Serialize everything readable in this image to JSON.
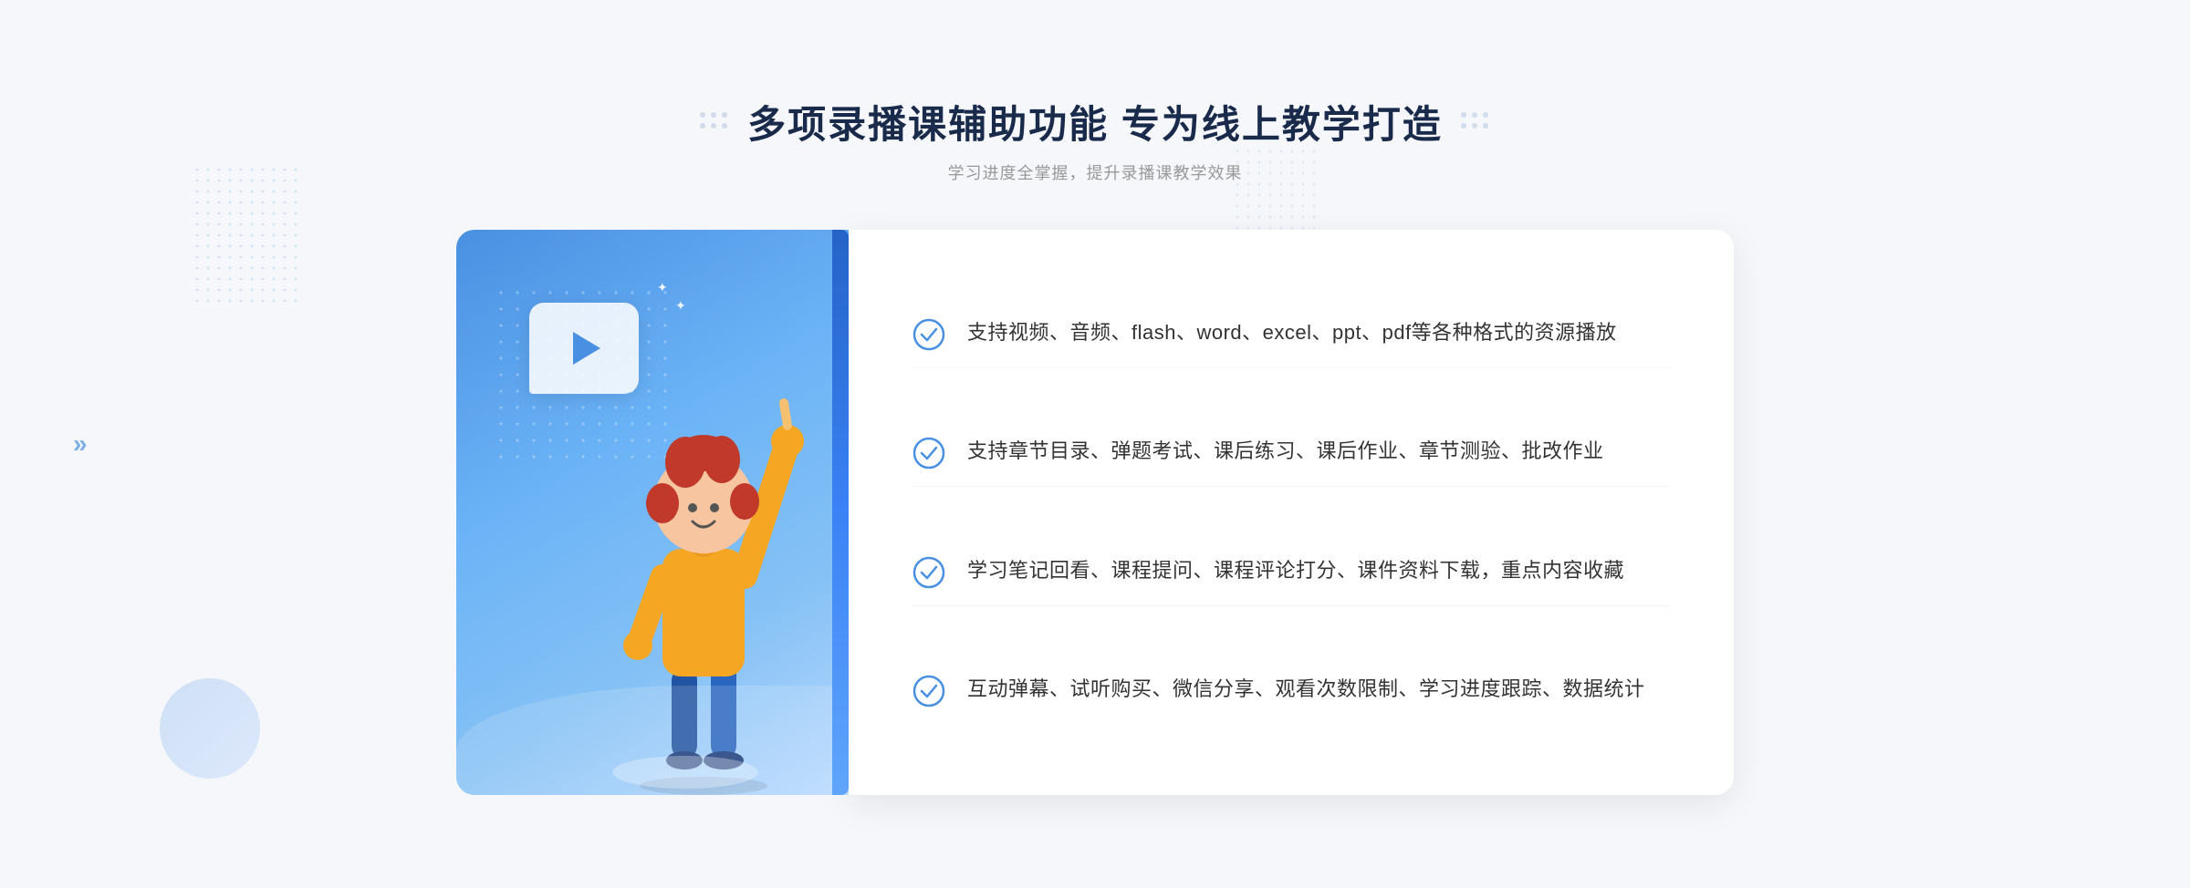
{
  "header": {
    "title": "多项录播课辅助功能 专为线上教学打造",
    "subtitle": "学习进度全掌握，提升录播课教学效果",
    "decorator_left": "⠿",
    "decorator_right": "⠿"
  },
  "features": [
    {
      "id": "feature-1",
      "text": "支持视频、音频、flash、word、excel、ppt、pdf等各种格式的资源播放"
    },
    {
      "id": "feature-2",
      "text": "支持章节目录、弹题考试、课后练习、课后作业、章节测验、批改作业"
    },
    {
      "id": "feature-3",
      "text": "学习笔记回看、课程提问、课程评论打分、课件资料下载，重点内容收藏"
    },
    {
      "id": "feature-4",
      "text": "互动弹幕、试听购买、微信分享、观看次数限制、学习进度跟踪、数据统计"
    }
  ],
  "colors": {
    "primary": "#4a90e2",
    "title": "#1a2a4a",
    "subtitle": "#999999",
    "text": "#333333",
    "check": "#4a90e2"
  }
}
